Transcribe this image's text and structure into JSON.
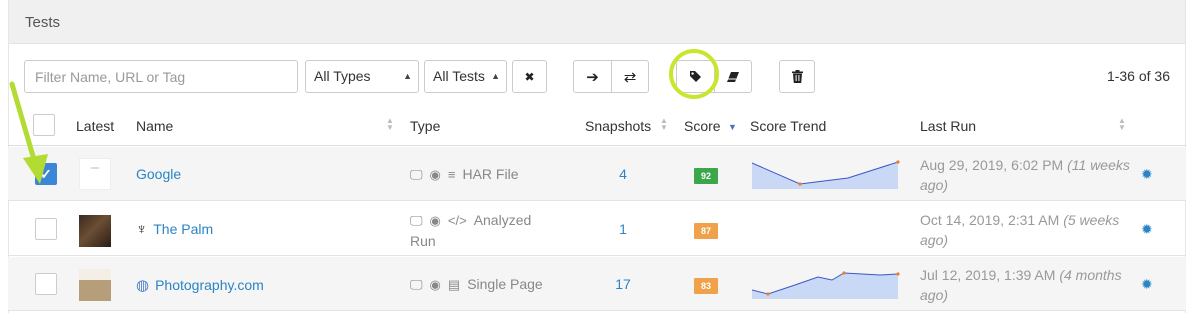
{
  "panel": {
    "title": "Tests"
  },
  "toolbar": {
    "filter_placeholder": "Filter Name, URL or Tag",
    "type_select": "All Types",
    "test_select": "All Tests",
    "clear_label": "✖",
    "move_label": "➔",
    "compare_label": "⇄",
    "pager": "1-36 of 36"
  },
  "columns": {
    "latest": "Latest",
    "name": "Name",
    "type": "Type",
    "snapshots": "Snapshots",
    "score": "Score",
    "score_trend": "Score Trend",
    "last_run": "Last Run"
  },
  "rows": [
    {
      "checked": true,
      "name": "Google",
      "type": "HAR File",
      "snapshots": "4",
      "score": "92",
      "score_color": "#3ca64a",
      "last_run": "Aug 29, 2019, 6:02 PM",
      "last_run_ago": "(11 weeks ago)"
    },
    {
      "checked": false,
      "name": "The Palm",
      "type": "Analyzed Run",
      "snapshots": "1",
      "score": "87",
      "score_color": "#f0a24a",
      "last_run": "Oct 14, 2019, 2:31 AM",
      "last_run_ago": "(5 weeks ago)"
    },
    {
      "checked": false,
      "name": "Photography.com",
      "type": "Single Page",
      "snapshots": "17",
      "score": "83",
      "score_color": "#f0a24a",
      "last_run": "Jul 12, 2019, 1:39 AM",
      "last_run_ago": "(4 months ago)"
    }
  ],
  "colors": {
    "accent": "#2a84c6",
    "highlight": "#c8e62e",
    "sparkline_fill": "#c9d8f5",
    "sparkline_line": "#3a56c8"
  }
}
